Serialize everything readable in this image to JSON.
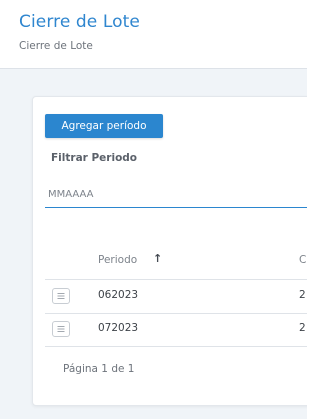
{
  "header": {
    "title": "Cierre de Lote",
    "breadcrumb": "Cierre de Lote"
  },
  "toolbar": {
    "add_period_label": "Agregar período"
  },
  "filter": {
    "label": "Filtrar Periodo",
    "placeholder": "MMAAAA",
    "value": ""
  },
  "table": {
    "columns": [
      {
        "label": "Periodo",
        "sort": "ascending",
        "sort_icon": "arrow-up-icon"
      },
      {
        "label": "C"
      }
    ],
    "rows": [
      {
        "periodo": "062023",
        "next": "2"
      },
      {
        "periodo": "072023",
        "next": "2"
      }
    ]
  },
  "pagination": {
    "text": "Página 1 de 1"
  },
  "colors": {
    "accent": "#2b86cf",
    "background": "#f0f4f8"
  }
}
